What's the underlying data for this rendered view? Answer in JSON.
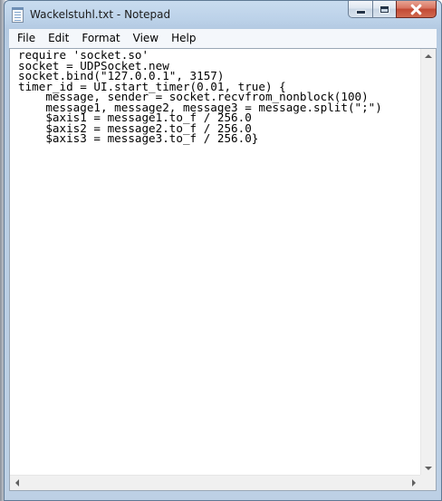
{
  "window": {
    "title": "Wackelstuhl.txt - Notepad",
    "app_icon": "notepad-icon"
  },
  "menu": [
    "File",
    "Edit",
    "Format",
    "View",
    "Help"
  ],
  "editor": {
    "lines": [
      "require 'socket.so'",
      "socket = UDPSocket.new",
      "socket.bind(\"127.0.0.1\", 3157)",
      "timer_id = UI.start_timer(0.01, true) {",
      "    message, sender = socket.recvfrom_nonblock(100)",
      "    message1, message2, message3 = message.split(\";\")",
      "    $axis1 = message1.to_f / 256.0",
      "    $axis2 = message2.to_f / 256.0",
      "    $axis3 = message3.to_f / 256.0}"
    ]
  }
}
